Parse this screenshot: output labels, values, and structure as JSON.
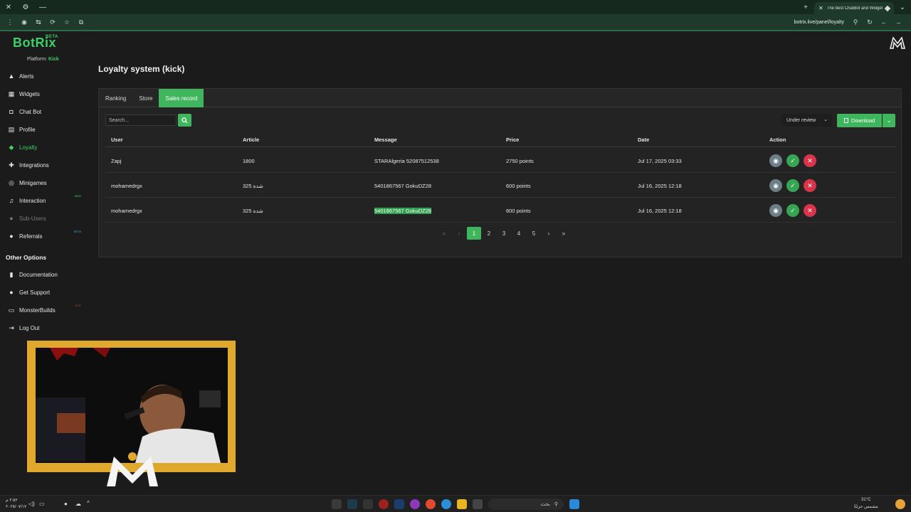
{
  "browser": {
    "tab_title": "The best ChatBot and Widgets",
    "url": "botrix.live/panel/loyalty"
  },
  "sidebar": {
    "logo": "BotRix",
    "logo_badge": "BETA",
    "platform_label": "Platform:",
    "platform_value": "Kick",
    "items": [
      {
        "label": "Alerts",
        "icon": "alert-triangle-icon"
      },
      {
        "label": "Widgets",
        "icon": "grid-icon"
      },
      {
        "label": "Chat Bot",
        "icon": "bot-icon"
      },
      {
        "label": "Profile",
        "icon": "id-card-icon"
      },
      {
        "label": "Loyalty",
        "icon": "gem-icon",
        "active": true
      },
      {
        "label": "Integrations",
        "icon": "puzzle-icon"
      },
      {
        "label": "Minigames",
        "icon": "gamepad-icon"
      },
      {
        "label": "Interaction",
        "icon": "music-note-icon",
        "badge": "NEW"
      },
      {
        "label": "Sub-Users",
        "icon": "user-gear-icon",
        "dim": true
      },
      {
        "label": "Referrals",
        "icon": "users-icon",
        "badge": "BETA"
      }
    ],
    "other_title": "Other Options",
    "other_items": [
      {
        "label": "Documentation",
        "icon": "book-icon"
      },
      {
        "label": "Get Support",
        "icon": "help-circle-icon"
      },
      {
        "label": "MonsterBuilds",
        "icon": "monitor-icon",
        "badge": "HOT"
      },
      {
        "label": "Log Out",
        "icon": "logout-icon"
      }
    ]
  },
  "page": {
    "title": "Loyalty system (kick)",
    "tabs": [
      "Ranking",
      "Store",
      "Sales record"
    ],
    "active_tab": 2,
    "search_placeholder": "Search...",
    "status_filter": "Under review",
    "download_label": "Download"
  },
  "table": {
    "columns": [
      "User",
      "Article",
      "Message",
      "Price",
      "Date",
      "Action"
    ],
    "rows": [
      {
        "user": "Zapj",
        "article": "1800",
        "message": "STARAlgeria 52087512538",
        "price": "2750 points",
        "date": "Jul 17, 2025 03:33"
      },
      {
        "user": "mohamedrgx",
        "article": "325 شدة",
        "message": "5401867567 GokuDZ28",
        "price": "600 points",
        "date": "Jul 16, 2025 12:18"
      },
      {
        "user": "mohamedrgx",
        "article": "325 شدة",
        "message": "5401867567 GokuDZ28",
        "price": "600 points",
        "date": "Jul 16, 2025 12:18",
        "message_selected": true
      }
    ]
  },
  "pagination": {
    "pages": [
      "1",
      "2",
      "3",
      "4",
      "5"
    ],
    "current": 1
  },
  "taskbar": {
    "search_text": "بحث",
    "weather": "31°C",
    "weather_sub": "مشمس جزئيًا",
    "clock_time": "٢:٥٢ م",
    "clock_date": "٢٠٢٥/٠٧/١٧"
  },
  "colors": {
    "accent": "#3fb65d",
    "brand": "#3fcf6a",
    "danger": "#d8344a",
    "view": "#6c7e86",
    "cam_frame": "#e0a82d"
  }
}
